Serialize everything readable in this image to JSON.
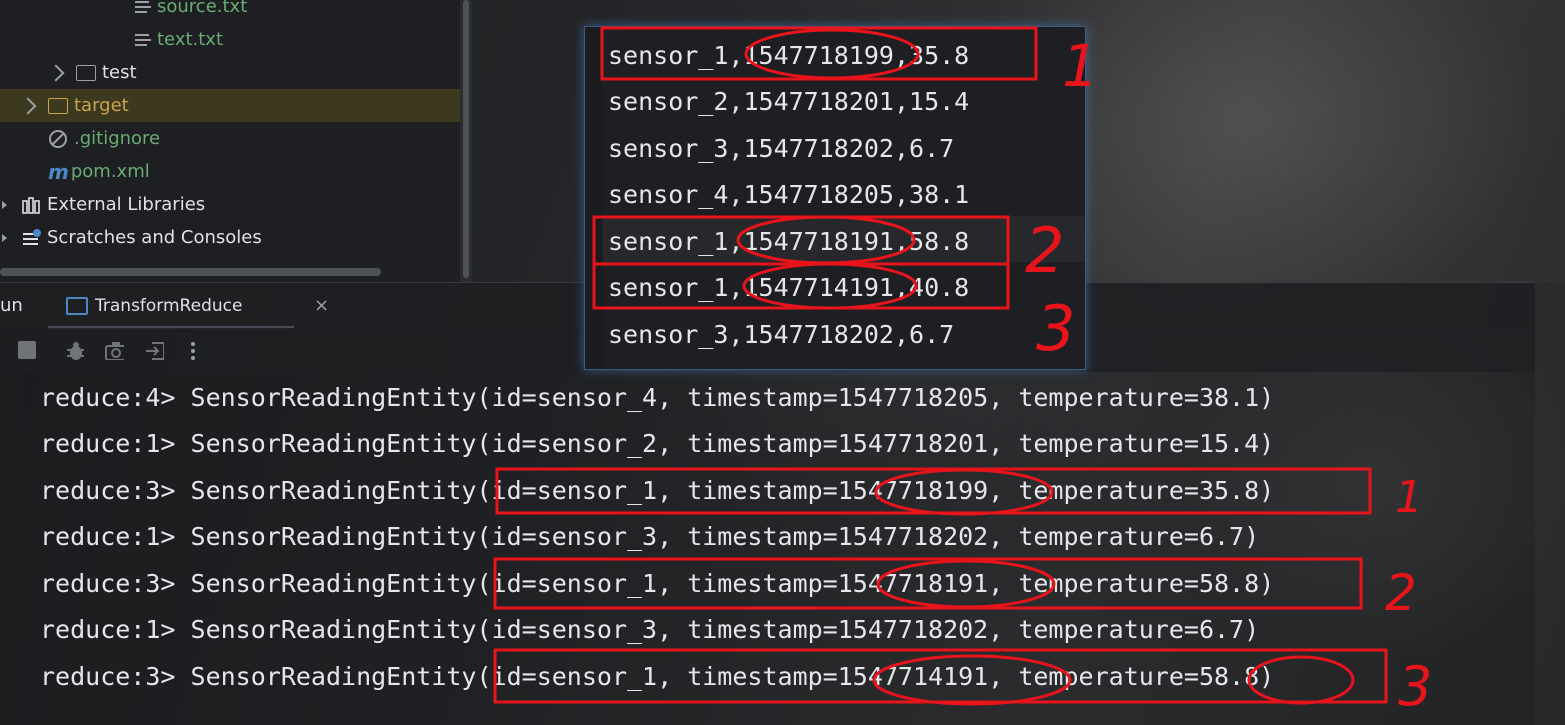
{
  "project_tree": {
    "items": [
      {
        "label": "source.txt",
        "kind": "file"
      },
      {
        "label": "text.txt",
        "kind": "file"
      },
      {
        "label": "test",
        "kind": "folder"
      },
      {
        "label": "target",
        "kind": "folder"
      },
      {
        "label": ".gitignore",
        "kind": "ignore"
      },
      {
        "label": "pom.xml",
        "kind": "maven"
      },
      {
        "label": "External Libraries",
        "kind": "libraries"
      },
      {
        "label": "Scratches and Consoles",
        "kind": "scratches"
      }
    ]
  },
  "run_panel": {
    "label": "un",
    "tab_label": "TransformReduce",
    "tab_close": "×"
  },
  "popup_lines": [
    "sensor_1,1547718199,35.8",
    "sensor_2,1547718201,15.4",
    "sensor_3,1547718202,6.7",
    "sensor_4,1547718205,38.1",
    "sensor_1,1547718191,58.8",
    "sensor_1,1547714191,40.8",
    "sensor_3,1547718202,6.7"
  ],
  "console_lines": [
    "reduce:4> SensorReadingEntity(id=sensor_4, timestamp=1547718205, temperature=38.1)",
    "reduce:1> SensorReadingEntity(id=sensor_2, timestamp=1547718201, temperature=15.4)",
    "reduce:3> SensorReadingEntity(id=sensor_1, timestamp=1547718199, temperature=35.8)",
    "reduce:1> SensorReadingEntity(id=sensor_3, timestamp=1547718202, temperature=6.7)",
    "reduce:3> SensorReadingEntity(id=sensor_1, timestamp=1547718191, temperature=58.8)",
    "reduce:1> SensorReadingEntity(id=sensor_3, timestamp=1547718202, temperature=6.7)",
    "reduce:3> SensorReadingEntity(id=sensor_1, timestamp=1547714191, temperature=58.8)"
  ],
  "annotations": {
    "color": "#e8141c",
    "numbers": [
      "1",
      "2",
      "3",
      "1",
      "2",
      "3"
    ]
  },
  "colors": {
    "file_green": "#6aab73",
    "target_yellow": "#c9a24d",
    "text": "#dfe1e5",
    "accent_blue": "#4a88c7"
  }
}
